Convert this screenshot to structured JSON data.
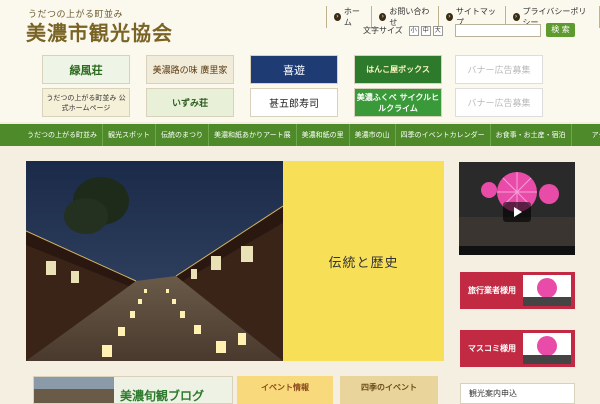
{
  "logo": {
    "subtitle": "うだつの上がる町並み",
    "title": "美濃市観光協会"
  },
  "topnav": [
    {
      "label": "ホーム"
    },
    {
      "label": "お問い合わせ"
    },
    {
      "label": "サイトマップ"
    },
    {
      "label": "プライバシーポリシー"
    }
  ],
  "fontsize": {
    "label": "文字サイズ",
    "small": "小",
    "medium": "中",
    "large": "大"
  },
  "search": {
    "placeholder": "",
    "button": "検 索"
  },
  "banners": [
    {
      "label": "緑風荘"
    },
    {
      "label": "美濃路の味 廣里家"
    },
    {
      "label": "喜遊"
    },
    {
      "label": "はんこ屋ボックス"
    },
    {
      "label": "バナー広告募集"
    },
    {
      "label": "うだつの上がる町並み 公式ホームページ"
    },
    {
      "label": "いずみ荘"
    },
    {
      "label": "甚五郎寿司"
    },
    {
      "label": "美濃ふくべ サイクルヒルクライム"
    },
    {
      "label": "バナー広告募集"
    }
  ],
  "mainnav": [
    "うだつの上がる町並み",
    "観光スポット",
    "伝統のまつり",
    "美濃和紙あかりアート展",
    "美濃和紙の里",
    "美濃市の山",
    "四季のイベントカレンダー",
    "お食事・お土産・宿泊",
    "アクセス"
  ],
  "hero": {
    "caption": "伝統と歴史"
  },
  "side": {
    "btn1": "旅行業者様用",
    "btn2": "マスコミ様用",
    "box": "観光案内申込"
  },
  "bottom": {
    "blog": "美濃旬観ブログ",
    "event": "イベント情報",
    "seasons": "四季のイベント"
  },
  "colors": {
    "nav": "#4e8a2a",
    "hero_text_bg": "#f7df57",
    "side_btn": "#c22a43"
  }
}
